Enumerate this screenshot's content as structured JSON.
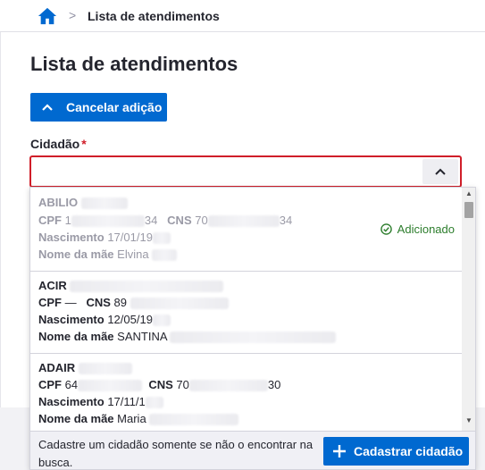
{
  "breadcrumb": {
    "current": "Lista de atendimentos",
    "separator": ">"
  },
  "page": {
    "title": "Lista de atendimentos"
  },
  "cancel_button": {
    "label": "Cancelar adição"
  },
  "field": {
    "label": "Cidadão",
    "required_mark": "*",
    "value": ""
  },
  "results": [
    {
      "name": "ABILIO",
      "cpf_label": "CPF",
      "cpf": "1",
      "cpf_tail": "34",
      "cns_label": "CNS",
      "cns": "70",
      "cns_tail": "34",
      "birth_label": "Nascimento",
      "birth": "17/01/19",
      "mother_label": "Nome da mãe",
      "mother": "Elvina",
      "status": "Adicionado",
      "disabled": true
    },
    {
      "name": "ACIR",
      "cpf_label": "CPF",
      "cpf": "—",
      "cns_label": "CNS",
      "cns": "89",
      "birth_label": "Nascimento",
      "birth": "12/05/19",
      "mother_label": "Nome da mãe",
      "mother": "SANTINA"
    },
    {
      "name": "ADAIR",
      "cpf_label": "CPF",
      "cpf": "64",
      "cns_label": "CNS",
      "cns": "70",
      "cns_tail": "30",
      "birth_label": "Nascimento",
      "birth": "17/11/1",
      "mother_label": "Nome da mãe",
      "mother": "Maria"
    }
  ],
  "footer": {
    "text": "Cadastre um cidadão somente se não o encontrar na busca.",
    "button_label": "Cadastrar cidadão"
  },
  "colors": {
    "primary": "#0069d0",
    "error": "#d01e29",
    "success": "#2c7d2c"
  }
}
